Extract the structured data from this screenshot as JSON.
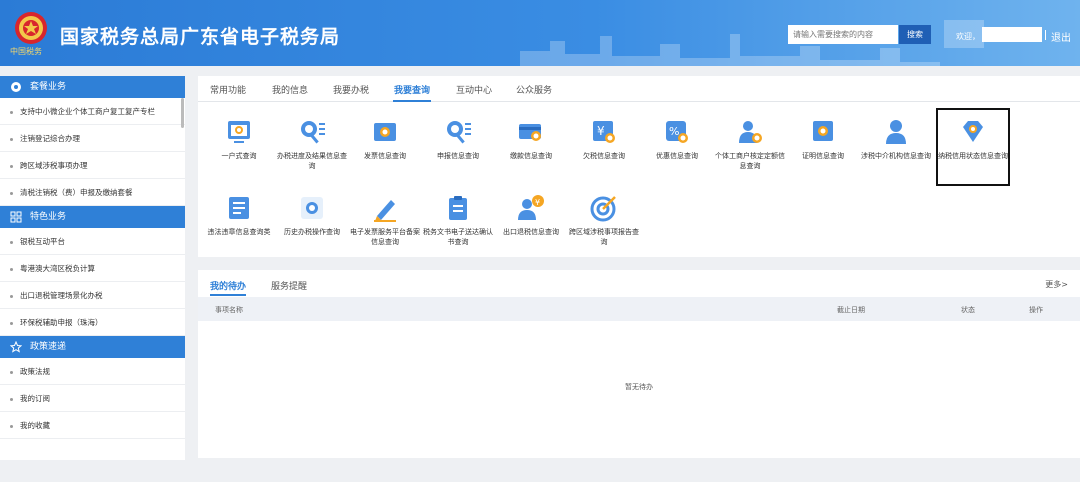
{
  "header": {
    "title": "国家税务总局广东省电子税务局",
    "emblem_caption": "中国税务",
    "search_placeholder": "请输入需要搜索的内容",
    "search_button": "搜索",
    "welcome": "欢迎，",
    "logout": "退出"
  },
  "sidebar": {
    "sections": [
      {
        "title": "套餐业务",
        "icon": "globe-icon",
        "items": [
          "支持中小微企业个体工商户复工复产专栏",
          "注销登记综合办理",
          "跨区域涉税事项办理",
          "清税注销税（费）申报及缴纳套餐"
        ]
      },
      {
        "title": "特色业务",
        "icon": "grid-icon",
        "items": [
          "银税互动平台",
          "粤港澳大湾区税负计算",
          "出口退税管理场景化办税",
          "环保税辅助申报（珠海）"
        ]
      },
      {
        "title": "政策速递",
        "icon": "star-icon",
        "items": [
          "政策法规",
          "我的订阅",
          "我的收藏"
        ]
      }
    ]
  },
  "main": {
    "tabs": [
      "常用功能",
      "我的信息",
      "我要办税",
      "我要查询",
      "互动中心",
      "公众服务"
    ],
    "active_tab": "我要查询",
    "tiles": [
      {
        "label": "一户式查询",
        "icon": "screen-search-icon"
      },
      {
        "label": "办税进度及结果信息查询",
        "icon": "search-list-icon"
      },
      {
        "label": "发票信息查询",
        "icon": "invoice-search-icon"
      },
      {
        "label": "申报信息查询",
        "icon": "search-list-icon"
      },
      {
        "label": "缴款信息查询",
        "icon": "card-search-icon"
      },
      {
        "label": "欠税信息查询",
        "icon": "yen-search-icon"
      },
      {
        "label": "优惠信息查询",
        "icon": "discount-icon"
      },
      {
        "label": "个体工商户核定定额信息查询",
        "icon": "person-search-icon"
      },
      {
        "label": "证明信息查询",
        "icon": "certificate-search-icon"
      },
      {
        "label": "涉税中介机构信息查询",
        "icon": "agent-icon"
      },
      {
        "label": "纳税信用状态信息查询",
        "icon": "diamond-search-icon"
      },
      {
        "label": "违法违章信息查询类",
        "icon": "document-icon"
      },
      {
        "label": "历史办税操作查询",
        "icon": "history-search-icon"
      },
      {
        "label": "电子发票服务平台备案信息查询",
        "icon": "pen-icon"
      },
      {
        "label": "税务文书电子送达确认书查询",
        "icon": "clipboard-icon"
      },
      {
        "label": "出口退税信息查询",
        "icon": "person-yen-icon"
      },
      {
        "label": "跨区域涉税事项报告查询",
        "icon": "target-icon"
      }
    ],
    "todo": {
      "tabs": [
        "我的待办",
        "服务提醒"
      ],
      "more": "更多>",
      "columns": [
        "事项名称",
        "截止日期",
        "状态",
        "操作"
      ],
      "empty_text": "暂无待办"
    }
  },
  "colors": {
    "primary": "#2f80d7",
    "header_start": "#2b7bd6",
    "header_end": "#6fb3ee"
  }
}
